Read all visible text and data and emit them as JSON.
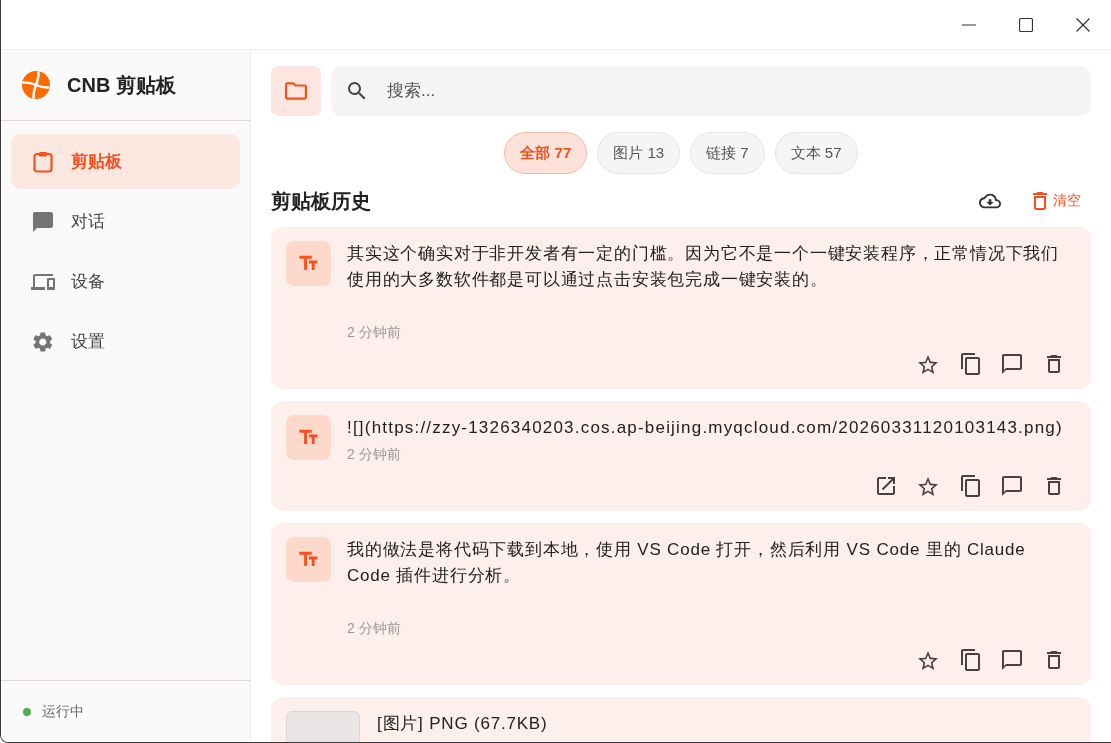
{
  "app": {
    "title": "CNB 剪贴板"
  },
  "sidebar": {
    "items": [
      {
        "label": "剪贴板",
        "selected": true
      },
      {
        "label": "对话",
        "selected": false
      },
      {
        "label": "设备",
        "selected": false
      },
      {
        "label": "设置",
        "selected": false
      }
    ],
    "status": {
      "label": "运行中",
      "running": true
    }
  },
  "search": {
    "placeholder": "搜索..."
  },
  "filters": [
    {
      "label": "全部 77",
      "selected": true
    },
    {
      "label": "图片 13",
      "selected": false
    },
    {
      "label": "链接 7",
      "selected": false
    },
    {
      "label": "文本 57",
      "selected": false
    }
  ],
  "history": {
    "title": "剪贴板历史",
    "clear_label": "清空",
    "items": [
      {
        "kind": "text",
        "text": "其实这个确实对于非开发者有一定的门槛。因为它不是一个一键安装程序，正常情况下我们使用的大多数软件都是可以通过点击安装包完成一键安装的。",
        "time": "2 分钟前",
        "starred": false
      },
      {
        "kind": "link",
        "text": "![](https://zzy-1326340203.cos.ap-beijing.myqcloud.com/20260331120103143.png)",
        "time": "2 分钟前",
        "starred": false
      },
      {
        "kind": "text",
        "text": "我的做法是将代码下载到本地，使用 VS Code 打开，然后利用 VS Code 里的 Claude Code 插件进行分析。",
        "time": "2 分钟前",
        "starred": false
      },
      {
        "kind": "image",
        "text": "[图片] PNG (67.7KB)"
      }
    ]
  }
}
